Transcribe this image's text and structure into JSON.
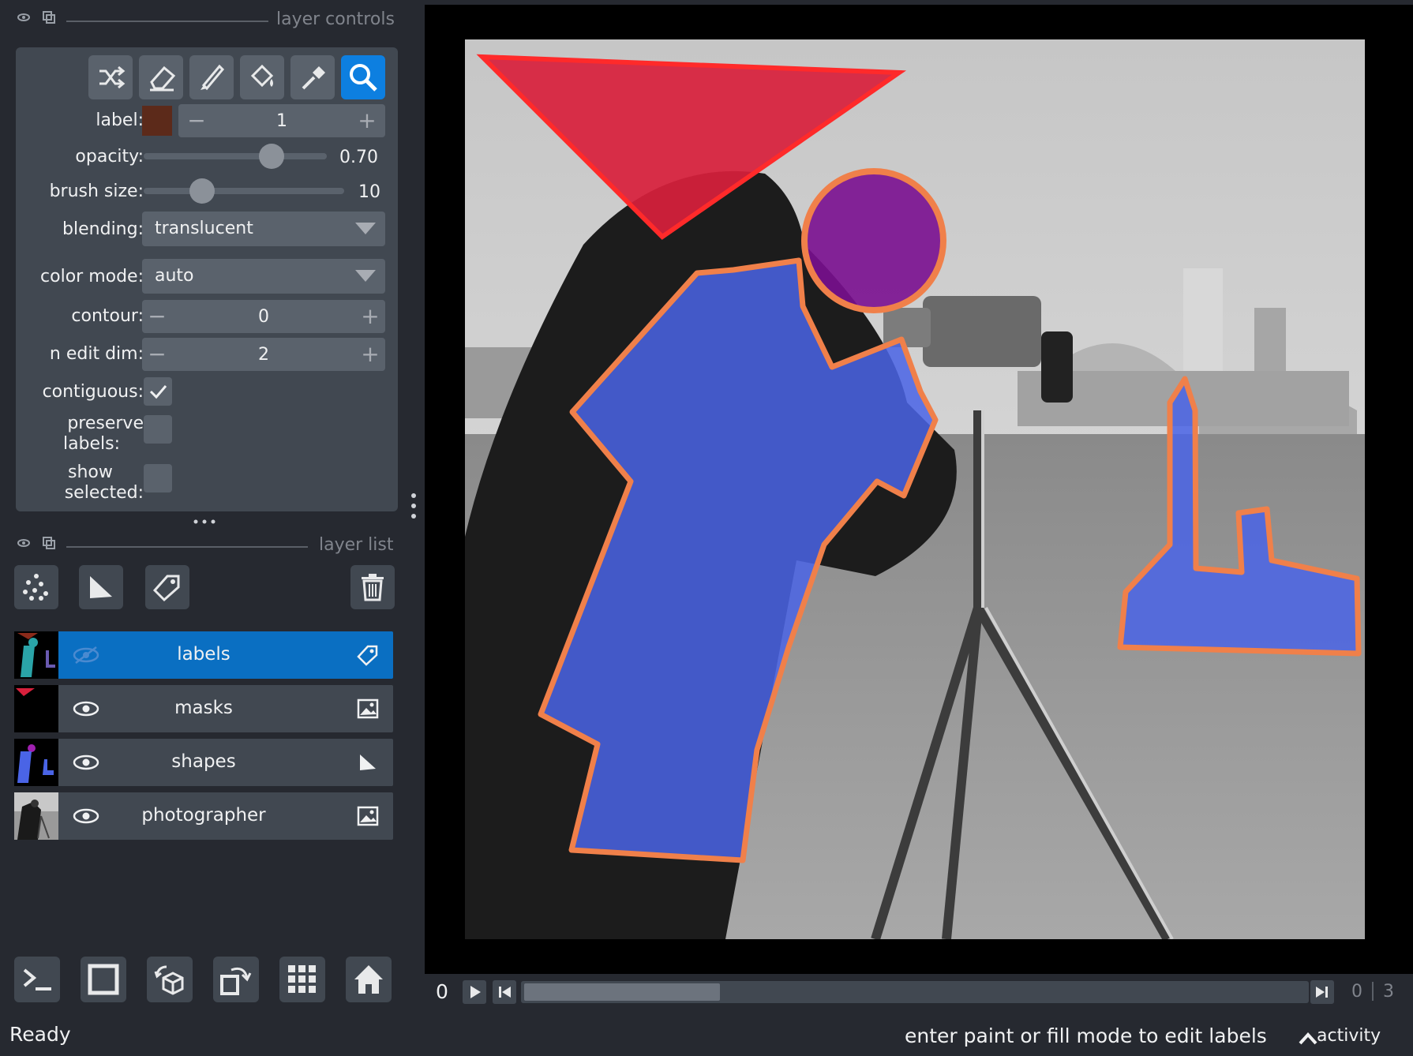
{
  "layer_controls": {
    "title": "layer controls",
    "tools": [
      {
        "name": "shuffle-colors",
        "active": false
      },
      {
        "name": "erase",
        "active": false
      },
      {
        "name": "paint",
        "active": false
      },
      {
        "name": "fill",
        "active": false
      },
      {
        "name": "pick",
        "active": false
      },
      {
        "name": "pan-zoom",
        "active": true
      }
    ],
    "label": {
      "caption": "label:",
      "value": "1",
      "swatch_color": "#5c2a1a"
    },
    "opacity": {
      "caption": "opacity:",
      "value": "0.70",
      "fraction": 0.7
    },
    "brush_size": {
      "caption": "brush size:",
      "value": "10",
      "fraction": 0.29
    },
    "blending": {
      "caption": "blending:",
      "value": "translucent"
    },
    "color_mode": {
      "caption": "color mode:",
      "value": "auto"
    },
    "contour": {
      "caption": "contour:",
      "value": "0"
    },
    "n_edit_dim": {
      "caption": "n edit dim:",
      "value": "2"
    },
    "contiguous": {
      "caption": "contiguous:",
      "checked": true
    },
    "preserve_labels": {
      "caption_1": "preserve",
      "caption_2": "labels:",
      "checked": false
    },
    "show_selected": {
      "caption_1": "show",
      "caption_2": "selected:",
      "checked": false
    }
  },
  "layer_list": {
    "title": "layer list",
    "layers": [
      {
        "name": "labels",
        "selected": true,
        "visible": true,
        "type_icon": "labels-icon"
      },
      {
        "name": "masks",
        "selected": false,
        "visible": true,
        "type_icon": "image-icon"
      },
      {
        "name": "shapes",
        "selected": false,
        "visible": true,
        "type_icon": "shapes-icon"
      },
      {
        "name": "photographer",
        "selected": false,
        "visible": true,
        "type_icon": "image-icon"
      }
    ]
  },
  "viewer_buttons": [
    "console",
    "ndisplay-toggle",
    "roll-dims",
    "transpose-dims",
    "grid-view",
    "reset-view"
  ],
  "dims": {
    "current": "0",
    "index": "0",
    "max": "3",
    "fraction": 0.25
  },
  "status": {
    "left": "Ready",
    "hint": "enter paint or fill mode to edit labels",
    "activity": "activity"
  },
  "colors": {
    "accent": "#0d7fe0",
    "selected_layer": "#0a6fc2",
    "panel": "#414851",
    "background": "#262930",
    "shape_fill": "#4a64e6",
    "shape_edge": "#f0804a",
    "mask_red": "#d8203c",
    "circle_purple": "#7a1090"
  }
}
